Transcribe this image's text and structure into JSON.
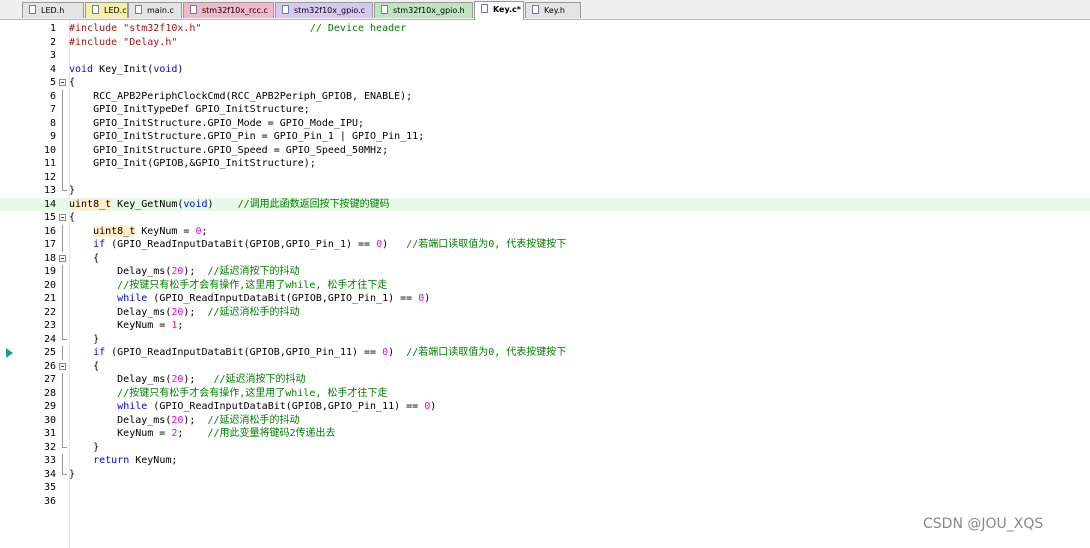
{
  "tabs": [
    {
      "label": "LED.h",
      "active": false,
      "color": "#e4e4e4"
    },
    {
      "label": "LED.c",
      "active": false,
      "color": "#f6f0a6"
    },
    {
      "label": "main.c",
      "active": false,
      "color": "#e4e4e4"
    },
    {
      "label": "stm32f10x_rcc.c",
      "active": false,
      "color": "#f2b8c6"
    },
    {
      "label": "stm32f10x_gpio.c",
      "active": false,
      "color": "#d8c8f0"
    },
    {
      "label": "stm32f10x_gpio.h",
      "active": false,
      "color": "#bfe5c0"
    },
    {
      "label": "Key.c*",
      "active": true,
      "color": "#ffffff"
    },
    {
      "label": "Key.h",
      "active": false,
      "color": "#e4e4e4"
    }
  ],
  "editor": {
    "current_line": 25,
    "highlighted_line": 14,
    "lines": [
      {
        "n": "1",
        "fold": "",
        "tokens": [
          [
            "str",
            "#include \"stm32f10x.h\""
          ],
          [
            "",
            "                  "
          ],
          [
            "cm",
            "// Device header"
          ]
        ]
      },
      {
        "n": "2",
        "fold": "",
        "tokens": [
          [
            "str",
            "#include \"Delay.h\""
          ]
        ]
      },
      {
        "n": "3",
        "fold": "",
        "tokens": []
      },
      {
        "n": "4",
        "fold": "",
        "tokens": [
          [
            "kw",
            "void"
          ],
          [
            "",
            " Key_Init("
          ],
          [
            "kw",
            "void"
          ],
          [
            "",
            ")"
          ]
        ]
      },
      {
        "n": "5",
        "fold": "open",
        "tokens": [
          [
            "",
            "{"
          ]
        ]
      },
      {
        "n": "6",
        "fold": "bar",
        "tokens": [
          [
            "",
            "    RCC_APB2PeriphClockCmd(RCC_APB2Periph_GPIOB, ENABLE);"
          ]
        ]
      },
      {
        "n": "7",
        "fold": "bar",
        "tokens": [
          [
            "",
            "    GPIO_InitTypeDef GPIO_InitStructure;"
          ]
        ]
      },
      {
        "n": "8",
        "fold": "bar",
        "tokens": [
          [
            "",
            "    GPIO_InitStructure.GPIO_Mode = GPIO_Mode_IPU;"
          ]
        ]
      },
      {
        "n": "9",
        "fold": "bar",
        "tokens": [
          [
            "",
            "    GPIO_InitStructure.GPIO_Pin = GPIO_Pin_1 | GPIO_Pin_11;"
          ]
        ]
      },
      {
        "n": "10",
        "fold": "bar",
        "tokens": [
          [
            "",
            "    GPIO_InitStructure.GPIO_Speed = GPIO_Speed_50MHz;"
          ]
        ]
      },
      {
        "n": "11",
        "fold": "bar",
        "tokens": [
          [
            "",
            "    GPIO_Init(GPIOB,&GPIO_InitStructure);"
          ]
        ]
      },
      {
        "n": "12",
        "fold": "bar",
        "tokens": []
      },
      {
        "n": "13",
        "fold": "end",
        "tokens": [
          [
            "",
            "}"
          ]
        ]
      },
      {
        "n": "14",
        "fold": "",
        "tokens": [
          [
            "ty",
            "uint8_t"
          ],
          [
            "",
            " Key_GetNum("
          ],
          [
            "kw",
            "void"
          ],
          [
            "",
            ")    "
          ],
          [
            "cm",
            "//调用此函数返回按下按键的键码"
          ]
        ]
      },
      {
        "n": "15",
        "fold": "open",
        "tokens": [
          [
            "",
            "{"
          ]
        ]
      },
      {
        "n": "16",
        "fold": "bar",
        "tokens": [
          [
            "",
            "    "
          ],
          [
            "ty",
            "uint8_t"
          ],
          [
            "",
            " KeyNum = "
          ],
          [
            "num",
            "0"
          ],
          [
            "",
            ";"
          ]
        ]
      },
      {
        "n": "17",
        "fold": "bar",
        "tokens": [
          [
            "",
            "    "
          ],
          [
            "kw",
            "if"
          ],
          [
            "",
            " (GPIO_ReadInputDataBit(GPIOB,GPIO_Pin_1) == "
          ],
          [
            "num",
            "0"
          ],
          [
            "",
            ")   "
          ],
          [
            "cm",
            "//若端口读取值为0, 代表按键按下"
          ]
        ]
      },
      {
        "n": "18",
        "fold": "open",
        "tokens": [
          [
            "",
            "    {"
          ]
        ]
      },
      {
        "n": "19",
        "fold": "bar",
        "tokens": [
          [
            "",
            "        Delay_ms("
          ],
          [
            "num",
            "20"
          ],
          [
            "",
            ");  "
          ],
          [
            "cm",
            "//延迟消按下的抖动"
          ]
        ]
      },
      {
        "n": "20",
        "fold": "bar",
        "tokens": [
          [
            "",
            "        "
          ],
          [
            "cm",
            "//按键只有松手才会有操作,这里用了while, 松手才往下走"
          ]
        ]
      },
      {
        "n": "21",
        "fold": "bar",
        "tokens": [
          [
            "",
            "        "
          ],
          [
            "kw",
            "while"
          ],
          [
            "",
            " (GPIO_ReadInputDataBit(GPIOB,GPIO_Pin_1) == "
          ],
          [
            "num",
            "0"
          ],
          [
            "",
            ")"
          ]
        ]
      },
      {
        "n": "22",
        "fold": "bar",
        "tokens": [
          [
            "",
            "        Delay_ms("
          ],
          [
            "num",
            "20"
          ],
          [
            "",
            ");  "
          ],
          [
            "cm",
            "//延迟消松手的抖动"
          ]
        ]
      },
      {
        "n": "23",
        "fold": "bar",
        "tokens": [
          [
            "",
            "        KeyNum = "
          ],
          [
            "num",
            "1"
          ],
          [
            "",
            ";"
          ]
        ]
      },
      {
        "n": "24",
        "fold": "end",
        "tokens": [
          [
            "",
            "    }"
          ]
        ]
      },
      {
        "n": "25",
        "fold": "bar",
        "tokens": [
          [
            "",
            "    "
          ],
          [
            "kw",
            "if"
          ],
          [
            "",
            " (GPIO_ReadInputDataBit(GPIOB,GPIO_Pin_11) == "
          ],
          [
            "num",
            "0"
          ],
          [
            "",
            ")  "
          ],
          [
            "cm",
            "//若端口读取值为0, 代表按键按下"
          ]
        ]
      },
      {
        "n": "26",
        "fold": "open",
        "tokens": [
          [
            "",
            "    {"
          ]
        ]
      },
      {
        "n": "27",
        "fold": "bar",
        "tokens": [
          [
            "",
            "        Delay_ms("
          ],
          [
            "num",
            "20"
          ],
          [
            "",
            ");   "
          ],
          [
            "cm",
            "//延迟消按下的抖动"
          ]
        ]
      },
      {
        "n": "28",
        "fold": "bar",
        "tokens": [
          [
            "",
            "        "
          ],
          [
            "cm",
            "//按键只有松手才会有操作,这里用了while, 松手才往下走"
          ]
        ]
      },
      {
        "n": "29",
        "fold": "bar",
        "tokens": [
          [
            "",
            "        "
          ],
          [
            "kw",
            "while"
          ],
          [
            "",
            " (GPIO_ReadInputDataBit(GPIOB,GPIO_Pin_11) == "
          ],
          [
            "num",
            "0"
          ],
          [
            "",
            ")"
          ]
        ]
      },
      {
        "n": "30",
        "fold": "bar",
        "tokens": [
          [
            "",
            "        Delay_ms("
          ],
          [
            "num",
            "20"
          ],
          [
            "",
            ");  "
          ],
          [
            "cm",
            "//延迟消松手的抖动"
          ]
        ]
      },
      {
        "n": "31",
        "fold": "bar",
        "tokens": [
          [
            "",
            "        KeyNum = "
          ],
          [
            "num",
            "2"
          ],
          [
            "",
            ";    "
          ],
          [
            "cm",
            "//用此变量将键码2传递出去"
          ]
        ]
      },
      {
        "n": "32",
        "fold": "end",
        "tokens": [
          [
            "",
            "    }"
          ]
        ]
      },
      {
        "n": "33",
        "fold": "bar",
        "tokens": [
          [
            "",
            "    "
          ],
          [
            "kw",
            "return"
          ],
          [
            "",
            " KeyNum;"
          ]
        ]
      },
      {
        "n": "34",
        "fold": "end",
        "tokens": [
          [
            "",
            "}"
          ]
        ]
      },
      {
        "n": "35",
        "fold": "",
        "tokens": []
      },
      {
        "n": "36",
        "fold": "",
        "tokens": []
      }
    ]
  },
  "watermark": "CSDN @JOU_XQS"
}
